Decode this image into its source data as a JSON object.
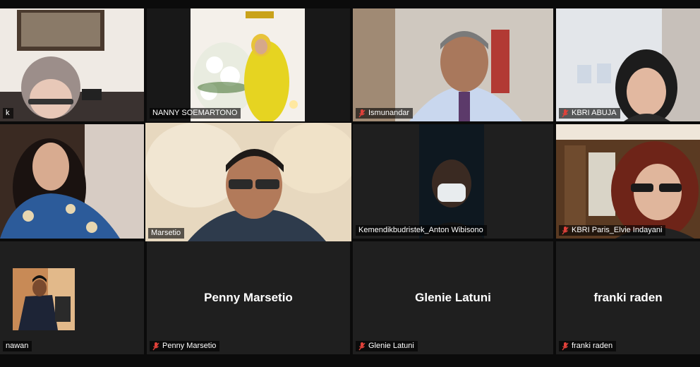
{
  "participants": [
    {
      "name": "k",
      "muted": false
    },
    {
      "name": "NANNY SOEMARTONO",
      "muted": false
    },
    {
      "name": "Ismunandar",
      "muted": true
    },
    {
      "name": "KBRI ABUJA",
      "muted": true
    },
    {
      "name": "",
      "muted": false
    },
    {
      "name": "Marsetio",
      "muted": false,
      "active_speaker": true
    },
    {
      "name": "Kemendikbudristek_Anton Wibisono",
      "muted": false
    },
    {
      "name": "KBRI Paris_Elvie Indayani",
      "muted": true
    },
    {
      "name": "nawan",
      "muted": false
    },
    {
      "name": "Penny Marsetio",
      "muted": true,
      "display_name": "Penny Marsetio"
    },
    {
      "name": "Glenie Latuni",
      "muted": true,
      "display_name": "Glenie Latuni"
    },
    {
      "name": "franki raden",
      "muted": true,
      "display_name": "franki raden"
    }
  ],
  "colors": {
    "active_border": "#d6d23a",
    "muted_icon": "#e0413a",
    "tile_bg": "#1f1f1f",
    "background": "#0b0b0b"
  }
}
